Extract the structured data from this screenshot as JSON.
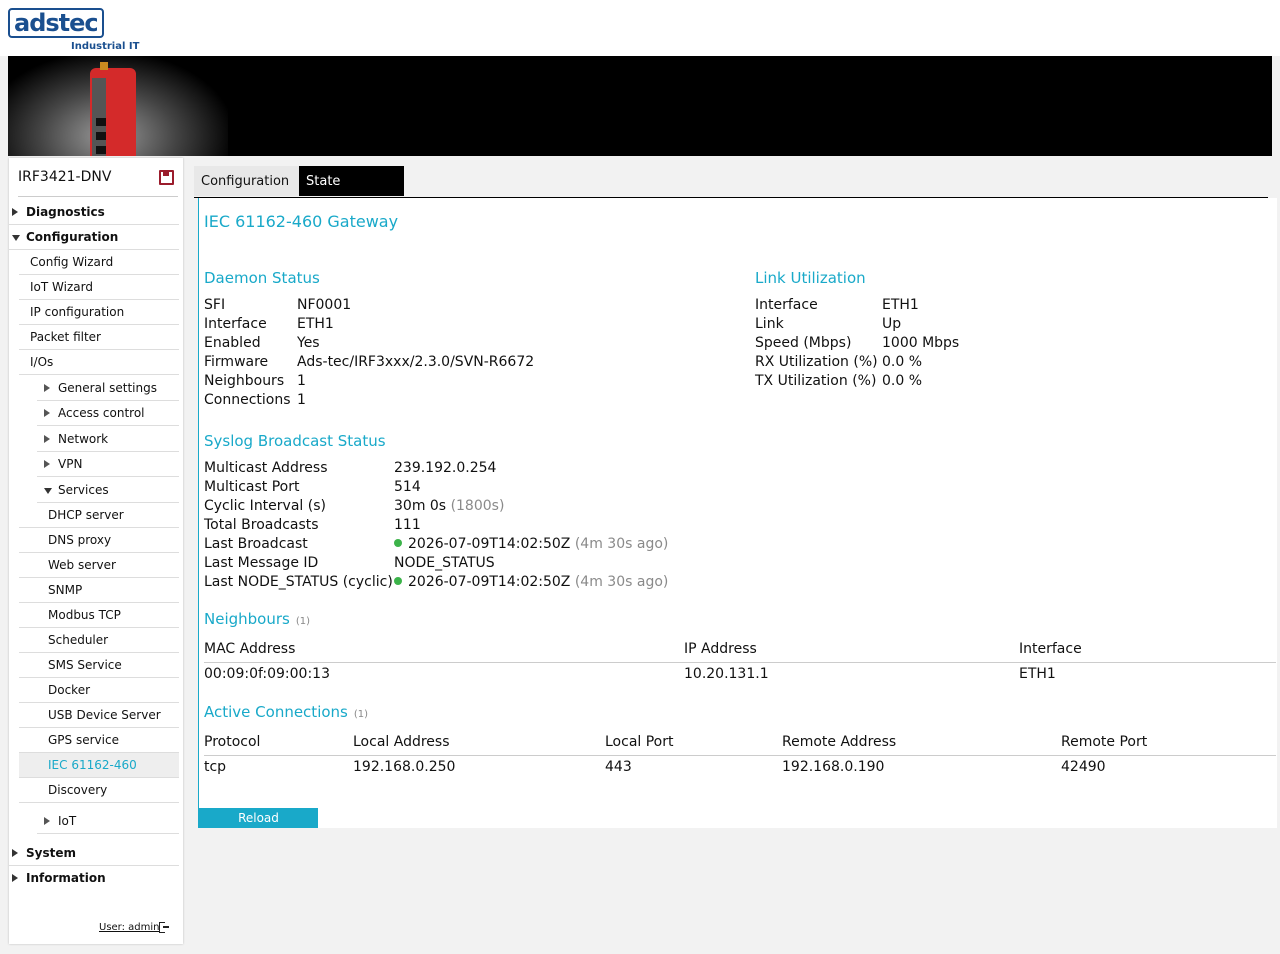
{
  "header": {
    "logo_text": "adstec",
    "logo_sub": "Industrial IT"
  },
  "sidebar": {
    "device_name": "IRF3421-DNV",
    "items": [
      {
        "label": "Diagnostics"
      },
      {
        "label": "Configuration"
      },
      {
        "label": "Config Wizard"
      },
      {
        "label": "IoT Wizard"
      },
      {
        "label": "IP configuration"
      },
      {
        "label": "Packet filter"
      },
      {
        "label": "I/Os"
      },
      {
        "label": "General settings"
      },
      {
        "label": "Access control"
      },
      {
        "label": "Network"
      },
      {
        "label": "VPN"
      },
      {
        "label": "Services"
      },
      {
        "label": "DHCP server"
      },
      {
        "label": "DNS proxy"
      },
      {
        "label": "Web server"
      },
      {
        "label": "SNMP"
      },
      {
        "label": "Modbus TCP"
      },
      {
        "label": "Scheduler"
      },
      {
        "label": "SMS Service"
      },
      {
        "label": "Docker"
      },
      {
        "label": "USB Device Server"
      },
      {
        "label": "GPS service"
      },
      {
        "label": "IEC 61162-460"
      },
      {
        "label": "Discovery"
      },
      {
        "label": "IoT"
      },
      {
        "label": "System"
      },
      {
        "label": "Information"
      }
    ],
    "user_label": "User: admin"
  },
  "tabs": {
    "configuration": "Configuration",
    "state": "State"
  },
  "page": {
    "title": "IEC 61162-460 Gateway",
    "daemon": {
      "heading": "Daemon Status",
      "rows": [
        {
          "k": "SFI",
          "v": "NF0001"
        },
        {
          "k": "Interface",
          "v": "ETH1"
        },
        {
          "k": "Enabled",
          "v": "Yes"
        },
        {
          "k": "Firmware",
          "v": "Ads-tec/IRF3xxx/2.3.0/SVN-R6672"
        },
        {
          "k": "Neighbours",
          "v": "1"
        },
        {
          "k": "Connections",
          "v": "1"
        }
      ]
    },
    "link": {
      "heading": "Link Utilization",
      "rows": [
        {
          "k": "Interface",
          "v": "ETH1"
        },
        {
          "k": "Link",
          "v": "Up"
        },
        {
          "k": "Speed (Mbps)",
          "v": "1000 Mbps"
        },
        {
          "k": "RX Utilization (%)",
          "v": "0.0 %"
        },
        {
          "k": "TX Utilization (%)",
          "v": "0.0 %"
        }
      ]
    },
    "syslog": {
      "heading": "Syslog Broadcast Status",
      "rows": [
        {
          "k": "Multicast Address",
          "v": "239.192.0.254",
          "extra": ""
        },
        {
          "k": "Multicast Port",
          "v": "514",
          "extra": ""
        },
        {
          "k": "Cyclic Interval (s)",
          "v": "30m 0s",
          "extra": "(1800s)"
        },
        {
          "k": "Total Broadcasts",
          "v": "111",
          "extra": ""
        },
        {
          "k": "Last Broadcast",
          "v": "2026-07-09T14:02:50Z",
          "extra": "(4m 30s ago)"
        },
        {
          "k": "Last Message ID",
          "v": "NODE_STATUS",
          "extra": ""
        },
        {
          "k": "Last NODE_STATUS (cyclic)",
          "v": "2026-07-09T14:02:50Z",
          "extra": "(4m 30s ago)"
        }
      ]
    },
    "neighbours": {
      "heading": "Neighbours",
      "count": "(1)",
      "columns": [
        "MAC Address",
        "IP Address",
        "Interface"
      ],
      "rows": [
        [
          "00:09:0f:09:00:13",
          "10.20.131.1",
          "ETH1"
        ]
      ]
    },
    "connections": {
      "heading": "Active Connections",
      "count": "(1)",
      "columns": [
        "Protocol",
        "Local Address",
        "Local Port",
        "Remote Address",
        "Remote Port"
      ],
      "rows": [
        [
          "tcp",
          "192.168.0.250",
          "443",
          "192.168.0.190",
          "42490"
        ]
      ]
    },
    "reload_label": "Reload"
  },
  "colors": {
    "accent": "#19a9c9",
    "brand": "#1a4f8f",
    "status_ok": "#3cb34a"
  }
}
